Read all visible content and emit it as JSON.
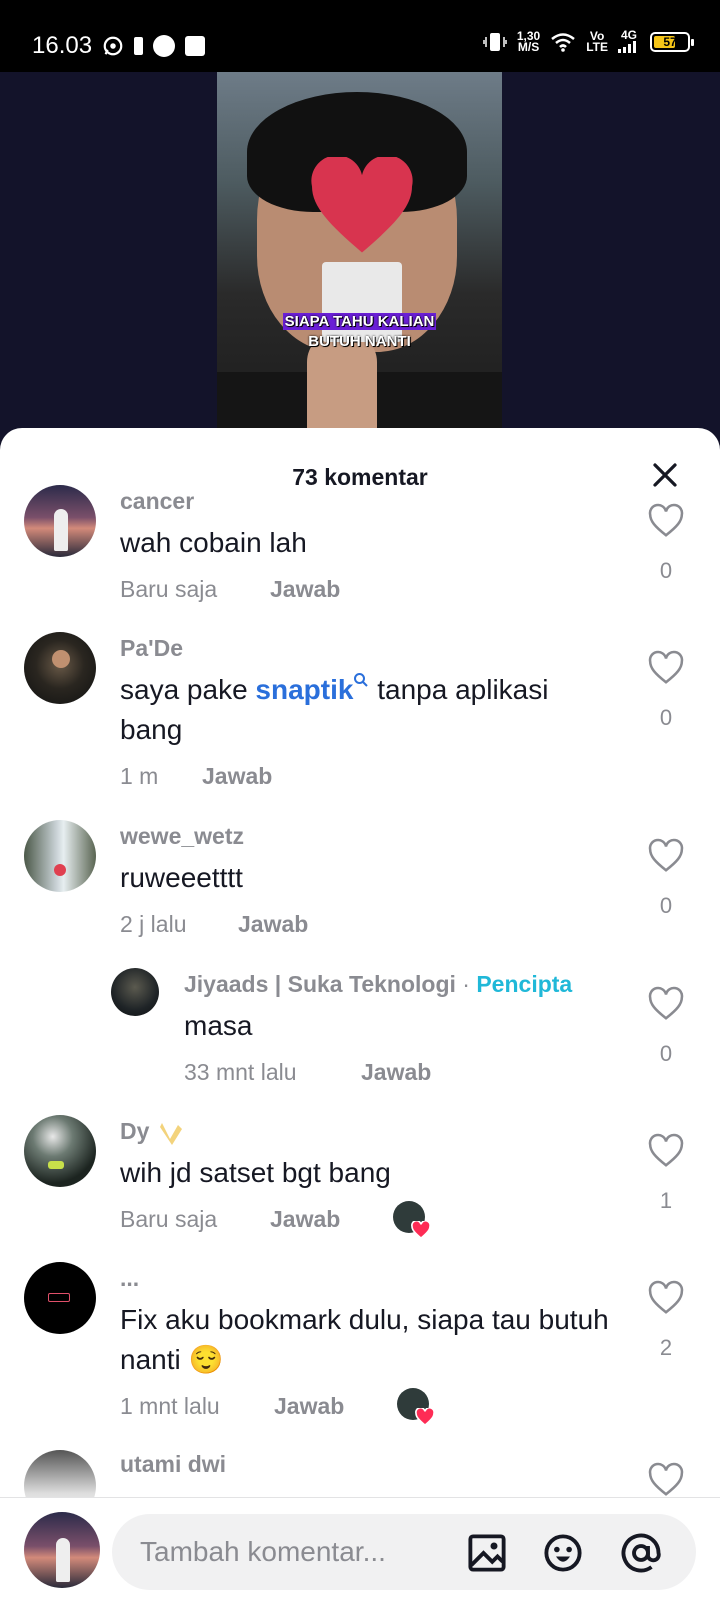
{
  "status_bar": {
    "time": "16.03",
    "speed_value": "1,30",
    "speed_unit": "M/S",
    "volte_top": "Vo",
    "volte_bottom": "LTE",
    "network": "4G",
    "battery": "57"
  },
  "video": {
    "caption_line1": "SIAPA TAHU KALIAN",
    "caption_line2": "BUTUH NANTI"
  },
  "comments_sheet": {
    "title": "73 komentar",
    "reply_label": "Jawab",
    "creator_badge": "Pencipta",
    "comments": [
      {
        "user": "cancer",
        "text": "wah cobain lah",
        "time": "Baru saja",
        "likes": "0"
      },
      {
        "user": "Pa'De",
        "text_before": "saya pake ",
        "link": "snaptik",
        "text_after": " tanpa aplikasi bang",
        "time": "1 m",
        "likes": "0"
      },
      {
        "user": "wewe_wetz",
        "text": "ruweeetttt",
        "time": "2 j lalu",
        "likes": "0"
      },
      {
        "user": "Jiyaads | Suka Teknologi",
        "separator": "·",
        "text": "masa",
        "time": "33 mnt lalu",
        "likes": "0"
      },
      {
        "user": "Dy",
        "text": "wih jd satset bgt bang",
        "time": "Baru saja",
        "likes": "1"
      },
      {
        "user": "...",
        "text": "Fix aku bookmark dulu, siapa tau butuh nanti 😌",
        "time": "1 mnt lalu",
        "likes": "2"
      },
      {
        "user": "utami dwi"
      }
    ]
  },
  "input_bar": {
    "placeholder": "Tambah komentar..."
  },
  "colors": {
    "accent_link": "#2a6fdb",
    "creator": "#20b8d8",
    "heart": "#fe2c55"
  }
}
